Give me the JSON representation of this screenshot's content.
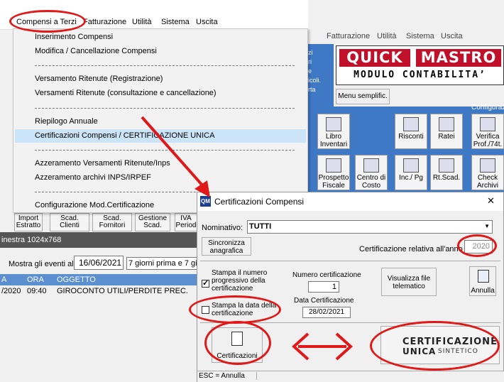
{
  "menubar": {
    "items": [
      "Compensi a Terzi",
      "Fatturazione",
      "Utilità",
      "Sistema",
      "Uscita"
    ]
  },
  "dropdown": {
    "items": [
      "Inserimento Compensi",
      "Modifica / Cancellazione Compensi",
      "Versamento Ritenute (Registrazione)",
      "Versamenti Ritenute (consultazione e cancellazione)",
      "Riepilogo Annuale",
      "Certificazioni Compensi / CERTIFICAZIONE UNICA",
      "Azzeramento Versamenti Ritenute/Inps",
      "Azzeramento archivi INPS/IRPEF",
      "Configurazione Mod.Certificazione"
    ]
  },
  "bg": {
    "menu": [
      "rzi",
      "Fatturazione",
      "Utilità",
      "Sistema",
      "Uscita"
    ],
    "logo": {
      "a": "QUICK",
      "b": "MASTRO",
      "sub": "MODULO  CONTABILITA’"
    },
    "menu_semplificato": "Menu semplific.",
    "configura": "Configuraz",
    "toolbar": [
      "Libro\nInventari",
      "Risconti",
      "Ratei",
      "Verifica\nProf./74t.",
      "Prospetto\nFiscale",
      "Centro di\nCosto",
      "Inc./ Pg",
      "Rt.Scad.",
      "Check\nArchivi"
    ],
    "panel_text": [
      "zi",
      "ri",
      "e",
      "icoli.",
      "rta"
    ],
    "left_buttons": [
      "Import\nEstratto",
      "Scad.\nClienti",
      "Scad.\nFornitori",
      "Gestione\nScad.",
      "IVA\nPeriod"
    ],
    "finestra": "inestra 1024x768",
    "events_label": "Mostra gli eventi al:",
    "events_date": "16/06/2021",
    "events_range": "7 giorni prima e 7 gior",
    "headers": [
      "A",
      "ORA",
      "OGGETTO"
    ],
    "row": [
      "/2020",
      "09:40",
      "GIROCONTO UTILI/PERDITE PREC."
    ]
  },
  "dialog": {
    "app_icon": "QM",
    "title": "Certificazioni Compensi",
    "close": "✕",
    "nominativo_label": "Nominativo:",
    "nominativo_value": "TUTTI",
    "sincronizza": "Sincronizza\nanagrafica",
    "anno_label": "Certificazione relativa all'anno",
    "anno_value": "2020",
    "cb1": "Stampa il numero\nprogressivo della\ncertificazione",
    "cb2": "Stampa la data della\ncertificazione",
    "num_label": "Numero certificazione",
    "num_value": "1",
    "data_label": "Data Certificazione",
    "data_value": "28/02/2021",
    "visualizza": "Visualizza file\ntelematico",
    "annulla": "Annulla",
    "certificazioni": "Certificazioni",
    "cu_line1": "CERTIFICAZIONE",
    "cu_line2a": "UNICA",
    "cu_line2b": "SINTETICO",
    "status": "ESC = Annulla"
  },
  "colors": {
    "annotation": "#e01818",
    "selection": "#cce4f7",
    "brand_red": "#c0102a",
    "panel_blue": "#3f78c4"
  }
}
